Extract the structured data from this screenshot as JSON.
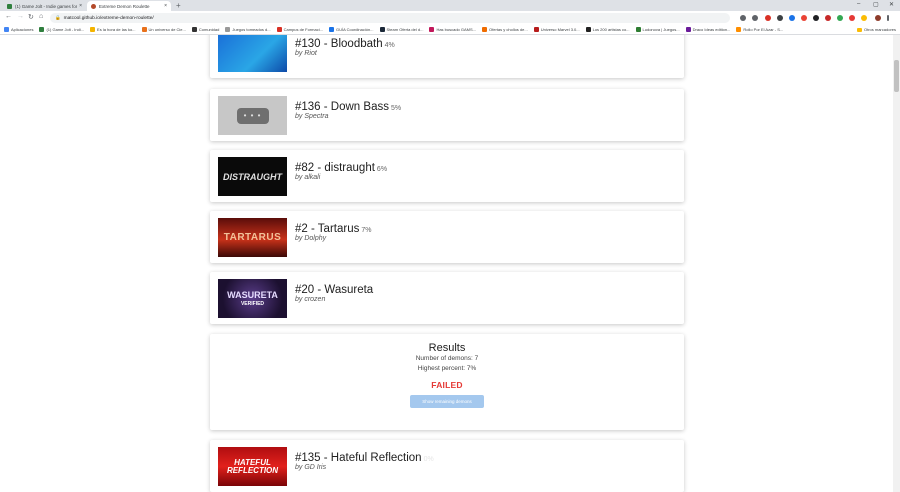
{
  "browser": {
    "tabs": [
      {
        "title": "(1) Game Jolt - Indie games for t",
        "close": "×",
        "active": false,
        "favicon_color": "#2f7f3e"
      },
      {
        "title": "Extreme Demon Roulette",
        "close": "×",
        "active": true,
        "favicon_color": "#b34a2a"
      }
    ],
    "new_tab": "+",
    "window_controls": [
      "–",
      "▢",
      "✕"
    ],
    "nav": {
      "back": "←",
      "forward": "→",
      "reload": "↻",
      "home": "⌂"
    },
    "url": "matcool.github.io/extreme-demon-roulette/",
    "bookmarks": [
      {
        "label": "Aplicaciones",
        "color": "#4285f4"
      },
      {
        "label": "(1) Game Jolt - Indi...",
        "color": "#2f7f3e"
      },
      {
        "label": "Es la hora de las ko...",
        "color": "#f4b400"
      },
      {
        "label": "Un universo de Cie...",
        "color": "#e8711c"
      },
      {
        "label": "Comunidad",
        "color": "#333333"
      },
      {
        "label": "Juegos tomeados d...",
        "color": "#999999"
      },
      {
        "label": "Campus de Formaci...",
        "color": "#d93025"
      },
      {
        "label": "GUÍA Coordinación...",
        "color": "#1a73e8"
      },
      {
        "label": "Steam Oferta del d...",
        "color": "#1b2838"
      },
      {
        "label": "Has buscado GAMS...",
        "color": "#c2185b"
      },
      {
        "label": "Ofertas y chollos de...",
        "color": "#ef6c00"
      },
      {
        "label": "Universo Marvel 3.0...",
        "color": "#b71c1c"
      },
      {
        "label": "Los 200 artistas co...",
        "color": "#212121"
      },
      {
        "label": "Ludonova | Juegos...",
        "color": "#2e7d32"
      },
      {
        "label": "Draco Ideas edition...",
        "color": "#6a1b9a"
      },
      {
        "label": "Rollo Por El Azar - S...",
        "color": "#ff8f00"
      }
    ],
    "bookmarks_other": "Otros marcadores"
  },
  "demons_top": [
    {
      "title": "#130 - Bloodbath",
      "percent": "4%",
      "creator": "by Riot",
      "thumb_class": "bloodbath",
      "thumb_text": ""
    },
    {
      "title": "#136 - Down Bass",
      "percent": "5%",
      "creator": "by Spectra",
      "thumb_class": "downbass",
      "thumb_text": "• • •"
    },
    {
      "title": "#82 - distraught",
      "percent": "6%",
      "creator": "by alkali",
      "thumb_class": "distraught",
      "thumb_text": "DISTRAUGHT"
    },
    {
      "title": "#2 - Tartarus",
      "percent": "7%",
      "creator": "by Dolphy",
      "thumb_class": "tartarus",
      "thumb_text": "TARTARUS"
    },
    {
      "title": "#20 - Wasureta",
      "percent": "",
      "creator": "by crozen",
      "thumb_class": "wasureta",
      "thumb_text": "WASURETA",
      "thumb_sub": "VERIFIED"
    }
  ],
  "results": {
    "title": "Results",
    "num_demons": "Number of demons: 7",
    "highest": "Highest percent: 7%",
    "status": "FAILED",
    "button": "Show remaining demons"
  },
  "demon_bottom": {
    "title": "#135 - Hateful Reflection",
    "percent": "0%",
    "creator": "by GD Iris",
    "thumb_text": "HATEFUL REFLECTION"
  }
}
